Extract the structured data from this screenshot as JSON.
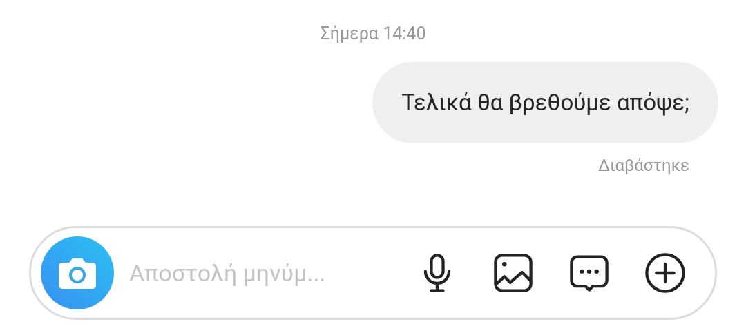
{
  "timestamp": "Σήμερα 14:40",
  "messages": [
    {
      "text": "Τελικά θα βρεθούμε απόψε;",
      "outgoing": true
    }
  ],
  "read_receipt": "Διαβάστηκε",
  "composer": {
    "placeholder": "Αποστολή μηνύμ...",
    "actions": [
      {
        "kind": "microphone"
      },
      {
        "kind": "gallery"
      },
      {
        "kind": "chat"
      },
      {
        "kind": "add"
      }
    ]
  }
}
